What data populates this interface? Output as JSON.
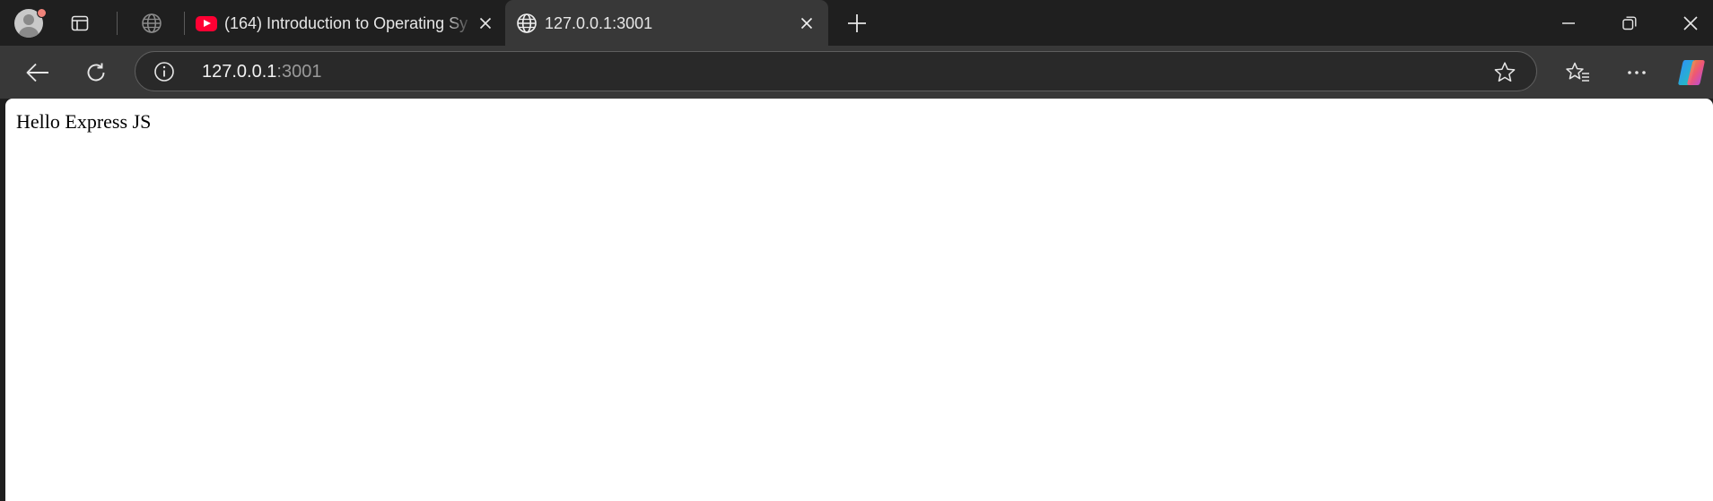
{
  "browser": {
    "tabs": [
      {
        "title": "(164) Introduction to Operating Sy",
        "favicon": "youtube-icon",
        "active": false
      },
      {
        "title": "127.0.0.1:3001",
        "favicon": "globe-icon",
        "active": true
      }
    ],
    "address_bar": {
      "host": "127.0.0.1",
      "port": ":3001"
    },
    "icons": {
      "profile": "profile-avatar-icon",
      "tab_actions": "tab-actions-icon",
      "workspaces": "globe-icon",
      "new_tab": "plus-icon",
      "back": "back-arrow-icon",
      "refresh": "refresh-icon",
      "site_info": "info-icon",
      "favorite": "star-icon",
      "favorites": "favorites-icon",
      "menu": "more-icon",
      "copilot": "copilot-icon",
      "minimize": "minimize-icon",
      "restore": "restore-icon",
      "close": "close-icon"
    },
    "colors": {
      "tabstrip": "#1f1f1f",
      "toolbar": "#383838",
      "youtube_red": "#ff0033",
      "notification_dot": "#f0837a"
    }
  },
  "page": {
    "body_text": "Hello Express JS"
  }
}
